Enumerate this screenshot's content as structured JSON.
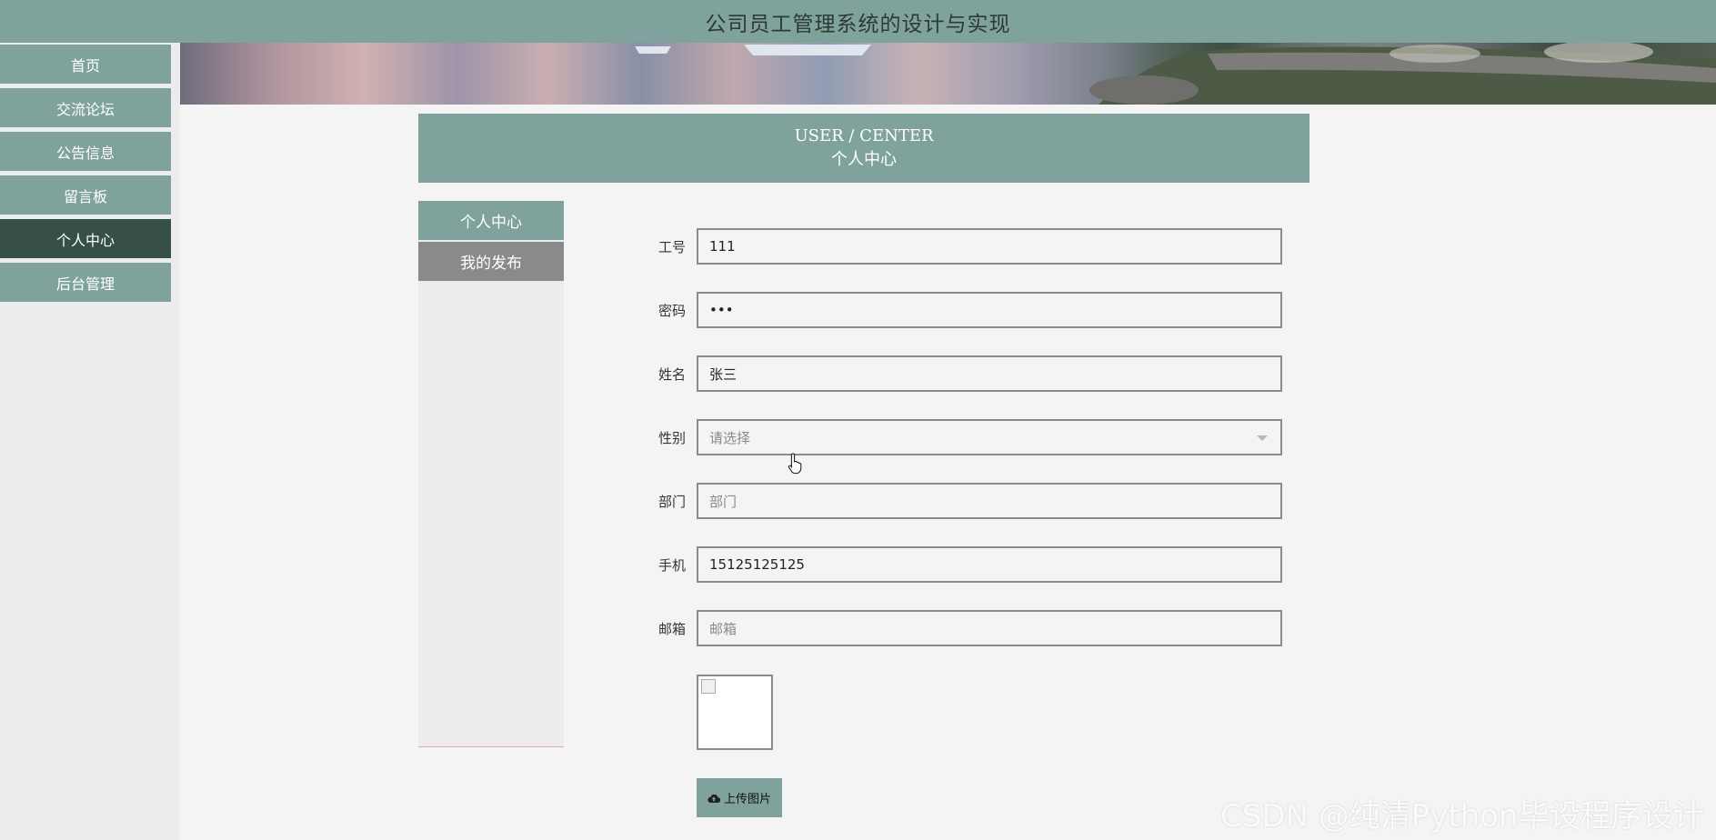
{
  "header": {
    "title": "公司员工管理系统的设计与实现"
  },
  "sidebar": {
    "items": [
      {
        "label": "首页"
      },
      {
        "label": "交流论坛"
      },
      {
        "label": "公告信息"
      },
      {
        "label": "留言板"
      },
      {
        "label": "个人中心",
        "active": true
      },
      {
        "label": "后台管理"
      }
    ]
  },
  "user_center": {
    "title_en": "USER / CENTER",
    "title_cn": "个人中心"
  },
  "subnav": {
    "items": [
      {
        "label": "个人中心"
      },
      {
        "label": "我的发布"
      }
    ]
  },
  "form": {
    "fields": [
      {
        "label": "工号",
        "value": "111"
      },
      {
        "label": "密码",
        "value": "•••"
      },
      {
        "label": "姓名",
        "value": "张三"
      },
      {
        "label": "性别",
        "placeholder": "请选择"
      },
      {
        "label": "部门",
        "placeholder": "部门"
      },
      {
        "label": "手机",
        "value": "15125125125"
      },
      {
        "label": "邮箱",
        "placeholder": "邮箱"
      }
    ],
    "upload_label": "上传图片"
  },
  "watermark": "CSDN @纯清Python毕设程序设计",
  "colors": {
    "primary": "#7fa39c",
    "active_nav": "#365049",
    "secondary_nav": "#8a8a8a",
    "background": "#f4f4f4"
  }
}
